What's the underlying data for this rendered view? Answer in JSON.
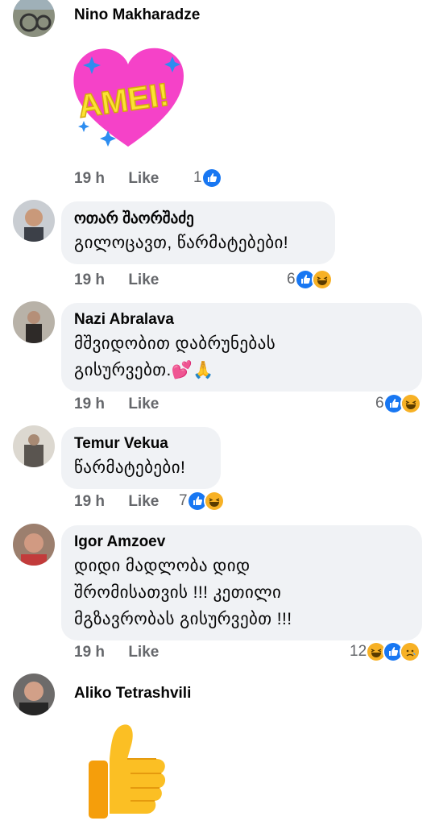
{
  "comments": [
    {
      "author": "Nino Makharadze",
      "sticker": "AMEI!",
      "time": "19 h",
      "like_label": "Like",
      "reaction_count": "1"
    },
    {
      "author": "ოთარ შაორშაძე",
      "lines": [
        "გილოცავთ, წარმატებები!"
      ],
      "time": "19 h",
      "like_label": "Like",
      "reaction_count": "6"
    },
    {
      "author": "Nazi Abralava",
      "lines": [
        "მშვიდობით დაბრუნებას",
        "გისურვებთ.💕🙏"
      ],
      "time": "19 h",
      "like_label": "Like",
      "reaction_count": "6"
    },
    {
      "author": "Temur Vekua",
      "lines": [
        "წარმატებები!"
      ],
      "time": "19 h",
      "like_label": "Like",
      "reaction_count": "7"
    },
    {
      "author": "Igor Amzoev",
      "lines": [
        "დიდი მადლობა დიდ",
        "შრომისათვის !!! კეთილი",
        "მგზავრობას გისურვებთ !!!"
      ],
      "time": "19 h",
      "like_label": "Like",
      "reaction_count": "12"
    },
    {
      "author": "Aliko Tetrashvili",
      "sticker": "thumbs-up"
    }
  ],
  "colors": {
    "bubble": "#f0f2f5",
    "meta": "#65676b",
    "like_blue": "#1877f2",
    "haha_yellow": "#f7b125"
  }
}
